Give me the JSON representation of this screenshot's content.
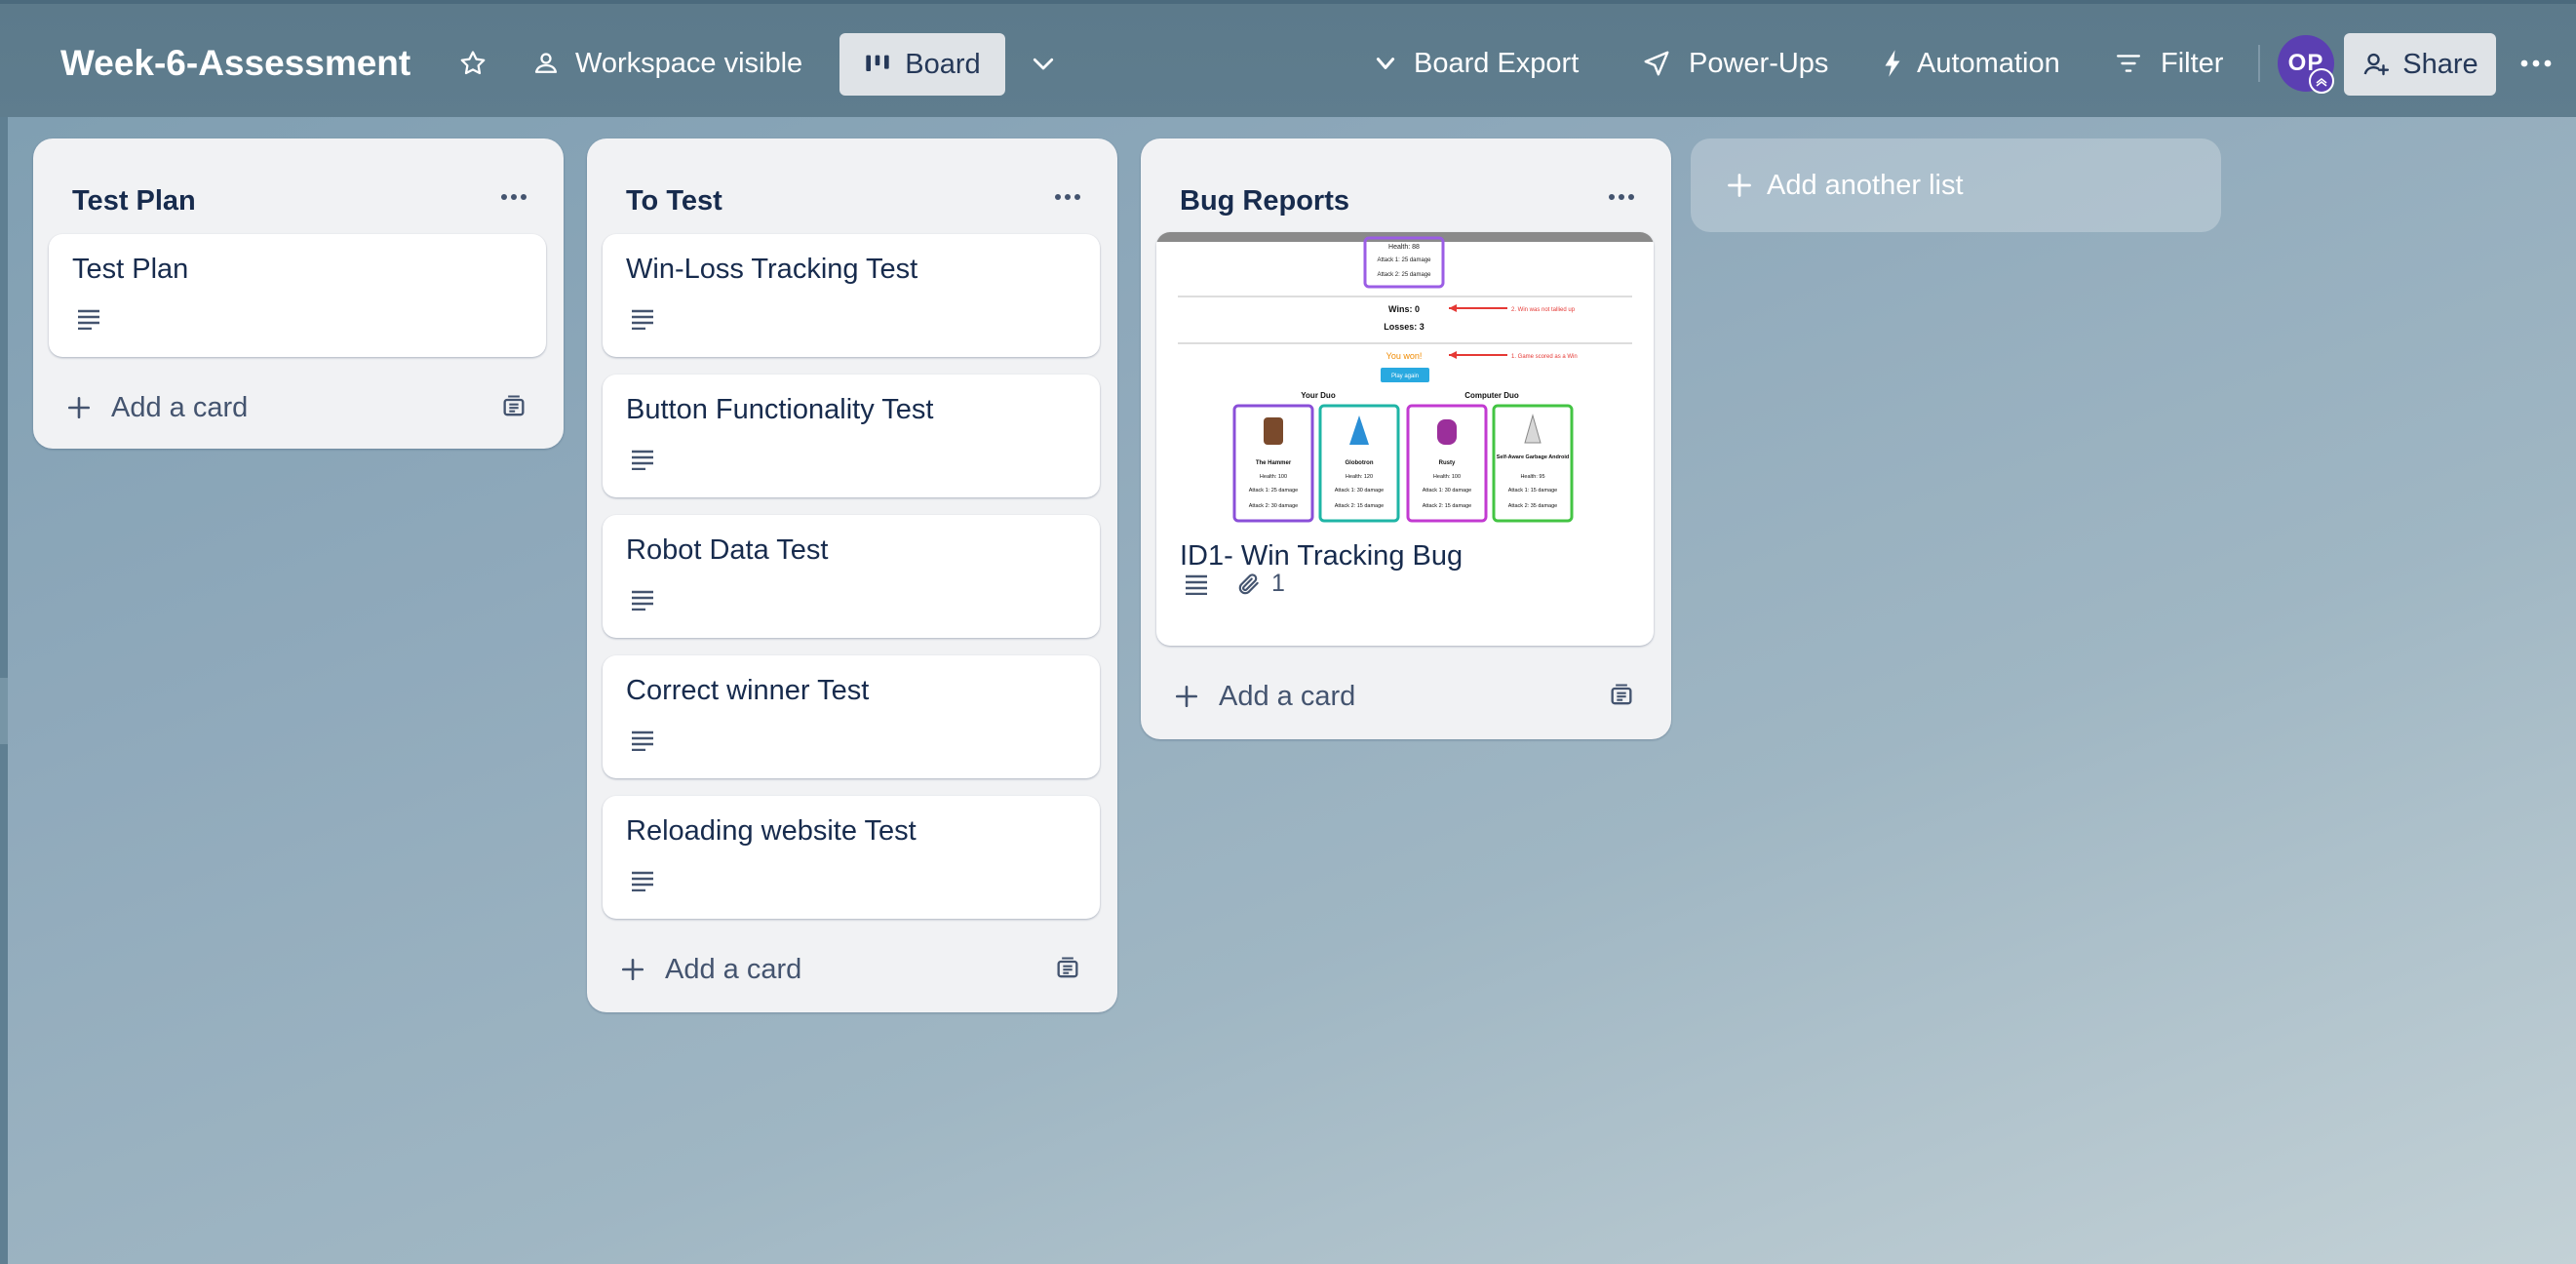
{
  "board": {
    "title": "Week-6-Assessment",
    "visibility_label": "Workspace visible",
    "view_label": "Board"
  },
  "toolbar": {
    "export_label": "Board Export",
    "powerups_label": "Power-Ups",
    "automation_label": "Automation",
    "filter_label": "Filter",
    "share_label": "Share",
    "avatar_initials": "OP"
  },
  "lists": [
    {
      "title": "Test Plan",
      "cards": [
        {
          "title": "Test Plan"
        }
      ],
      "add_card_label": "Add a card"
    },
    {
      "title": "To Test",
      "cards": [
        {
          "title": "Win-Loss Tracking Test"
        },
        {
          "title": "Button Functionality Test"
        },
        {
          "title": "Robot Data Test"
        },
        {
          "title": "Correct winner Test"
        },
        {
          "title": "Reloading website Test"
        }
      ],
      "add_card_label": "Add a card"
    },
    {
      "title": "Bug Reports",
      "cards": [
        {
          "title": "ID1- Win Tracking Bug",
          "attachments": "1",
          "cover": {
            "health_top": "Health: 88",
            "attack1_top": "Attack 1: 25 damage",
            "attack2_top": "Attack 2: 25 damage",
            "wins": "Wins: 0",
            "losses": "Losses: 3",
            "annot_wins": "2. Win was not tallied up",
            "you_won": "You won!",
            "annot_won": "1. Game scored as a Win",
            "play_again": "Play again",
            "your_duo": "Your Duo",
            "computer_duo": "Computer Duo",
            "bots": [
              {
                "name": "The Hammer",
                "health": "Health: 100",
                "a1": "Attack 1: 25 damage",
                "a2": "Attack 2: 30 damage",
                "color": "#7a4a2c"
              },
              {
                "name": "Globotron",
                "health": "Health: 120",
                "a1": "Attack 1: 30 damage",
                "a2": "Attack 2: 15 damage",
                "color": "#2b8fd6"
              },
              {
                "name": "Rusty",
                "health": "Health: 100",
                "a1": "Attack 1: 30 damage",
                "a2": "Attack 2: 15 damage",
                "color": "#9b2f9b"
              },
              {
                "name": "Self-Aware Garbage Android",
                "health": "Health: 95",
                "a1": "Attack 1: 15 damage",
                "a2": "Attack 2: 35 damage",
                "color": "#d8d8d8"
              }
            ]
          }
        }
      ],
      "add_card_label": "Add a card"
    }
  ],
  "add_list_label": "Add another list",
  "colors": {
    "header_bg": "#5f7d8e",
    "list_bg": "#f1f2f4",
    "avatar_bg": "#5b3fb2",
    "text_primary": "#172b4d"
  }
}
